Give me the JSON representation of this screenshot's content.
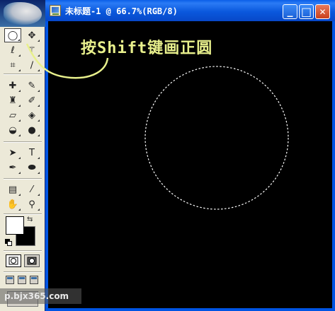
{
  "toolbox": {
    "tools": [
      {
        "name": "marquee-tool",
        "glyph": "◯",
        "selected": true
      },
      {
        "name": "move-tool",
        "glyph": "✥",
        "selected": false
      },
      {
        "name": "lasso-tool",
        "glyph": "ℓ",
        "selected": false
      },
      {
        "name": "magic-wand-tool",
        "glyph": "⚚",
        "selected": false
      },
      {
        "name": "crop-tool",
        "glyph": "⌗",
        "selected": false
      },
      {
        "name": "slice-tool",
        "glyph": "∕",
        "selected": false
      },
      {
        "name": "healing-brush-tool",
        "glyph": "✚",
        "selected": false
      },
      {
        "name": "brush-tool",
        "glyph": "✎",
        "selected": false
      },
      {
        "name": "clone-stamp-tool",
        "glyph": "♜",
        "selected": false
      },
      {
        "name": "history-brush-tool",
        "glyph": "✐",
        "selected": false
      },
      {
        "name": "eraser-tool",
        "glyph": "▱",
        "selected": false
      },
      {
        "name": "paint-bucket-tool",
        "glyph": "◈",
        "selected": false
      },
      {
        "name": "blur-tool",
        "glyph": "◒",
        "selected": false
      },
      {
        "name": "dodge-tool",
        "glyph": "●",
        "selected": false
      },
      {
        "name": "path-selection-tool",
        "glyph": "➤",
        "selected": false
      },
      {
        "name": "type-tool",
        "glyph": "T",
        "selected": false
      },
      {
        "name": "pen-tool",
        "glyph": "✒",
        "selected": false
      },
      {
        "name": "shape-tool",
        "glyph": "⬬",
        "selected": false
      },
      {
        "name": "notes-tool",
        "glyph": "▤",
        "selected": false
      },
      {
        "name": "eyedropper-tool",
        "glyph": "⁄",
        "selected": false
      },
      {
        "name": "hand-tool",
        "glyph": "✋",
        "selected": false
      },
      {
        "name": "zoom-tool",
        "glyph": "⚲",
        "selected": false
      }
    ],
    "foreground_color": "#ffffff",
    "background_color": "#000000"
  },
  "document": {
    "title": "未标题-1 @ 66.7%(RGB/8)",
    "minimize_label": "_",
    "maximize_label": "□",
    "close_label": "✕",
    "canvas_color": "#000000",
    "annotation_text": "按Shift键画正圆",
    "annotation_color": "#e8f08c",
    "selection_shape": "circle"
  },
  "watermark": {
    "text": "p.bjx365.com"
  },
  "colors": {
    "titlebar_blue": "#0a58dd",
    "toolbox_gray": "#ece9d8"
  }
}
